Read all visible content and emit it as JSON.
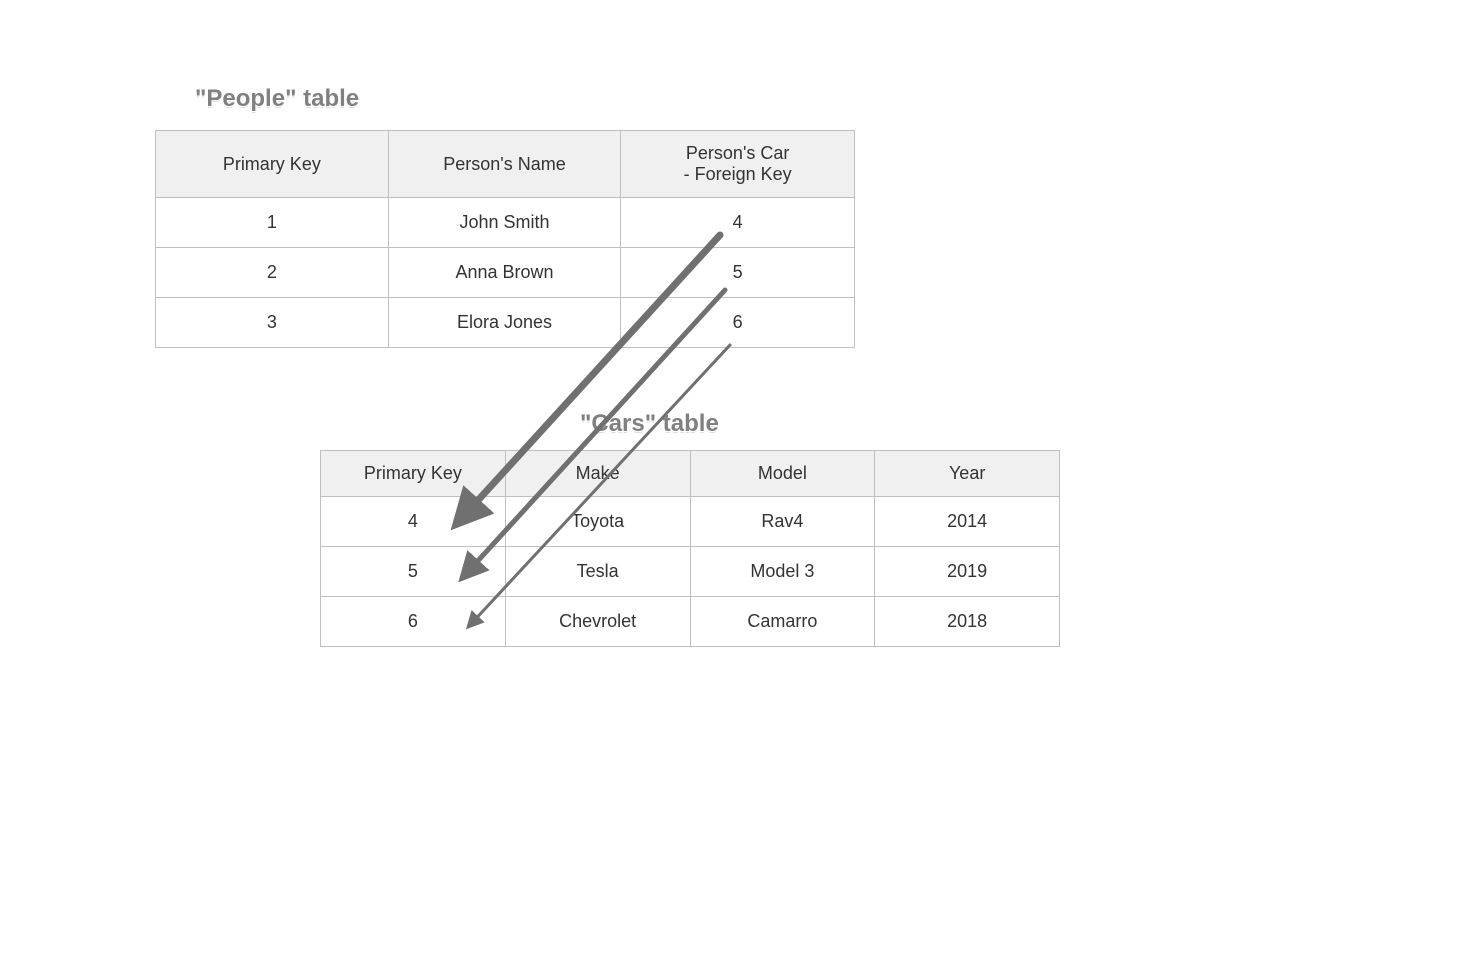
{
  "people": {
    "title": "\"People\" table",
    "headers": {
      "pk": "Primary Key",
      "name": "Person's Name",
      "fk": "Person's Car - Foreign Key"
    },
    "rows": [
      {
        "pk": "1",
        "name": "John Smith",
        "fk": "4"
      },
      {
        "pk": "2",
        "name": "Anna Brown",
        "fk": "5"
      },
      {
        "pk": "3",
        "name": "Elora Jones",
        "fk": "6"
      }
    ]
  },
  "cars": {
    "title": "\"Cars\" table",
    "headers": {
      "pk": "Primary Key",
      "make": "Make",
      "model": "Model",
      "year": "Year"
    },
    "rows": [
      {
        "pk": "4",
        "make": "Toyota",
        "model": "Rav4",
        "year": "2014"
      },
      {
        "pk": "5",
        "make": "Tesla",
        "model": "Model 3",
        "year": "2019"
      },
      {
        "pk": "6",
        "make": "Chevrolet",
        "model": "Camarro",
        "year": "2018"
      }
    ]
  }
}
